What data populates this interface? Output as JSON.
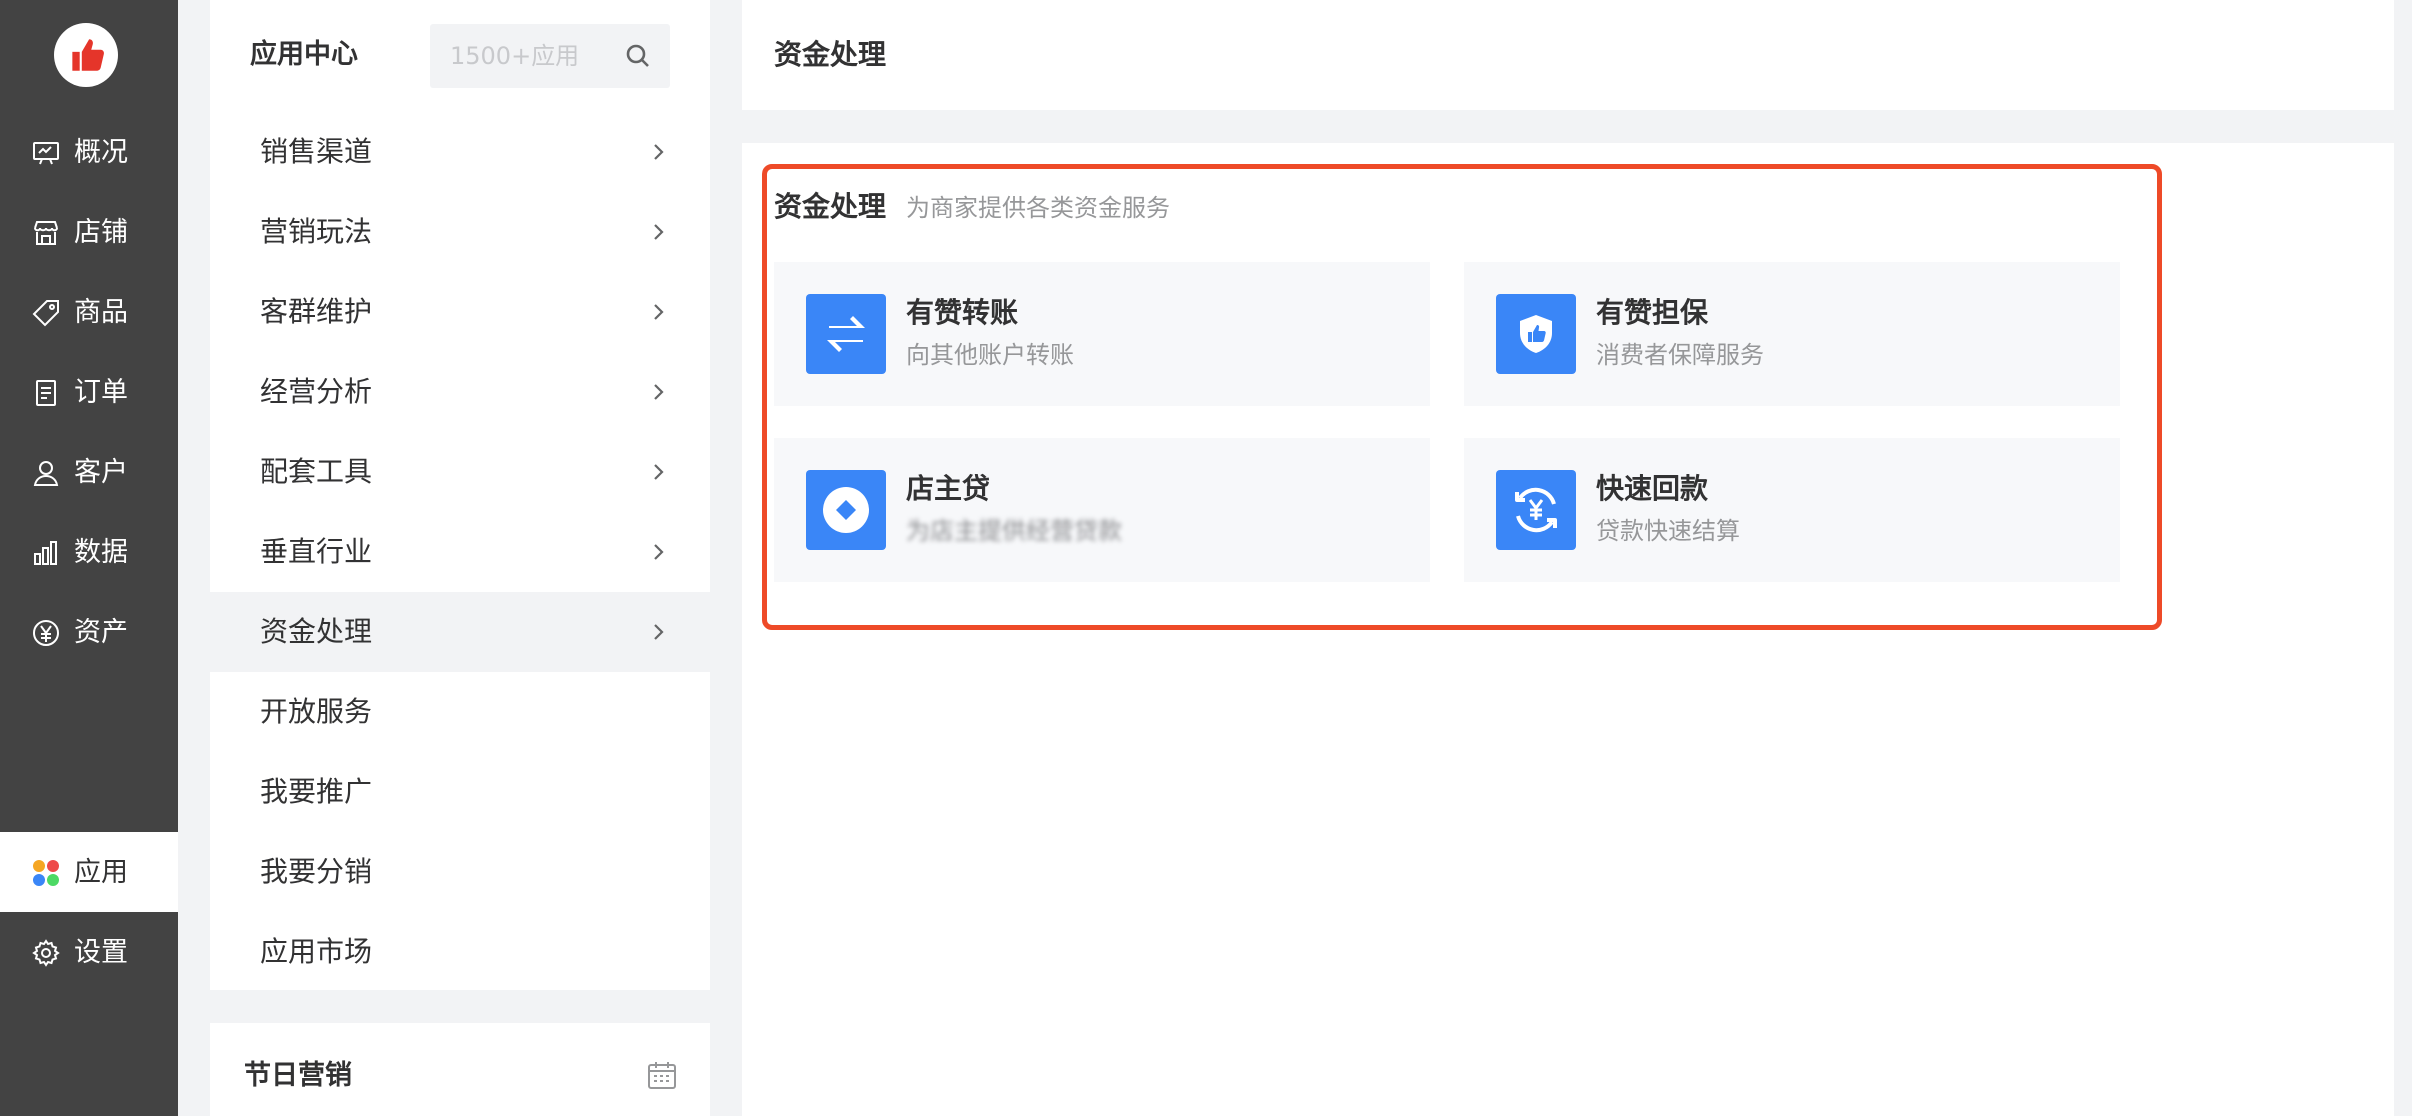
{
  "nav": {
    "items": [
      {
        "label": "概况",
        "icon": "dashboard-icon"
      },
      {
        "label": "店铺",
        "icon": "store-icon"
      },
      {
        "label": "商品",
        "icon": "tag-icon"
      },
      {
        "label": "订单",
        "icon": "order-icon"
      },
      {
        "label": "客户",
        "icon": "user-icon"
      },
      {
        "label": "数据",
        "icon": "chart-icon"
      },
      {
        "label": "资产",
        "icon": "yuan-icon"
      },
      {
        "label": "应用",
        "icon": "apps-icon",
        "active": true
      },
      {
        "label": "设置",
        "icon": "gear-icon"
      }
    ]
  },
  "menu": {
    "title": "应用中心",
    "search_placeholder": "1500+应用",
    "items": [
      {
        "label": "销售渠道",
        "has_chevron": true
      },
      {
        "label": "营销玩法",
        "has_chevron": true
      },
      {
        "label": "客群维护",
        "has_chevron": true
      },
      {
        "label": "经营分析",
        "has_chevron": true
      },
      {
        "label": "配套工具",
        "has_chevron": true
      },
      {
        "label": "垂直行业",
        "has_chevron": true
      },
      {
        "label": "资金处理",
        "has_chevron": true,
        "active": true
      },
      {
        "label": "开放服务",
        "has_chevron": false
      },
      {
        "label": "我要推广",
        "has_chevron": false
      },
      {
        "label": "我要分销",
        "has_chevron": false
      },
      {
        "label": "应用市场",
        "has_chevron": false
      }
    ],
    "section2_title": "节日营销"
  },
  "header": {
    "title": "资金处理"
  },
  "section": {
    "title": "资金处理",
    "subtitle": "为商家提供各类资金服务",
    "cards": [
      {
        "name": "有赞转账",
        "desc": "向其他账户转账",
        "icon": "transfer-icon"
      },
      {
        "name": "有赞担保",
        "desc": "消费者保障服务",
        "icon": "shield-like-icon"
      },
      {
        "name": "店主贷",
        "desc": "为店主提供经营贷款",
        "icon": "loan-icon",
        "blurred": true
      },
      {
        "name": "快速回款",
        "desc": "贷款快速结算",
        "icon": "refresh-yuan-icon"
      }
    ]
  },
  "colors": {
    "nav_bg": "#434343",
    "accent_blue": "#3a86f7",
    "highlight_red": "#ee4a28",
    "brand_red": "#e5352a"
  }
}
